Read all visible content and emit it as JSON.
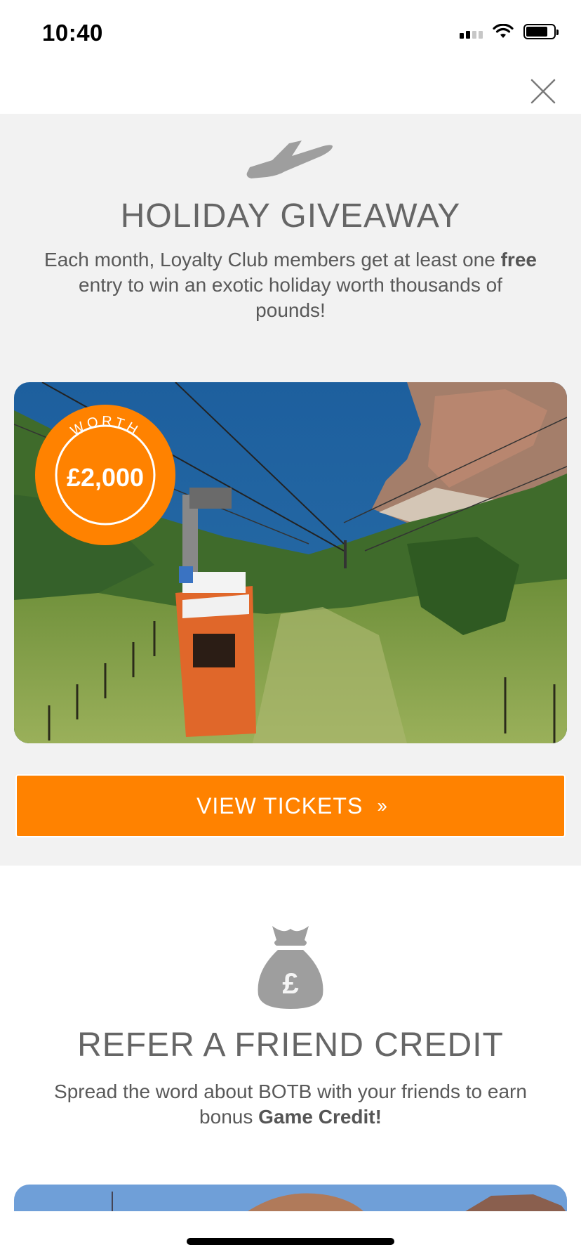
{
  "status_bar": {
    "time": "10:40"
  },
  "holiday": {
    "icon": "plane-icon",
    "title": "HOLIDAY GIVEAWAY",
    "desc_pre": "Each month, Loyalty Club members get at least one ",
    "desc_bold": "free",
    "desc_post": " entry to win an exotic holiday worth thousands of pounds!",
    "badge_top": "WORTH",
    "badge_value": "£2,000",
    "button_label": "VIEW TICKETS",
    "button_icon": "double-chevron-right-icon"
  },
  "refer": {
    "icon": "money-bag-icon",
    "bag_symbol": "£",
    "title": "REFER A FRIEND CREDIT",
    "desc_pre": "Spread the word about BOTB with your friends to earn bonus ",
    "desc_bold": "Game Credit!"
  },
  "colors": {
    "accent": "#ff8200",
    "title": "#666666",
    "section_bg": "#f2f2f2"
  }
}
